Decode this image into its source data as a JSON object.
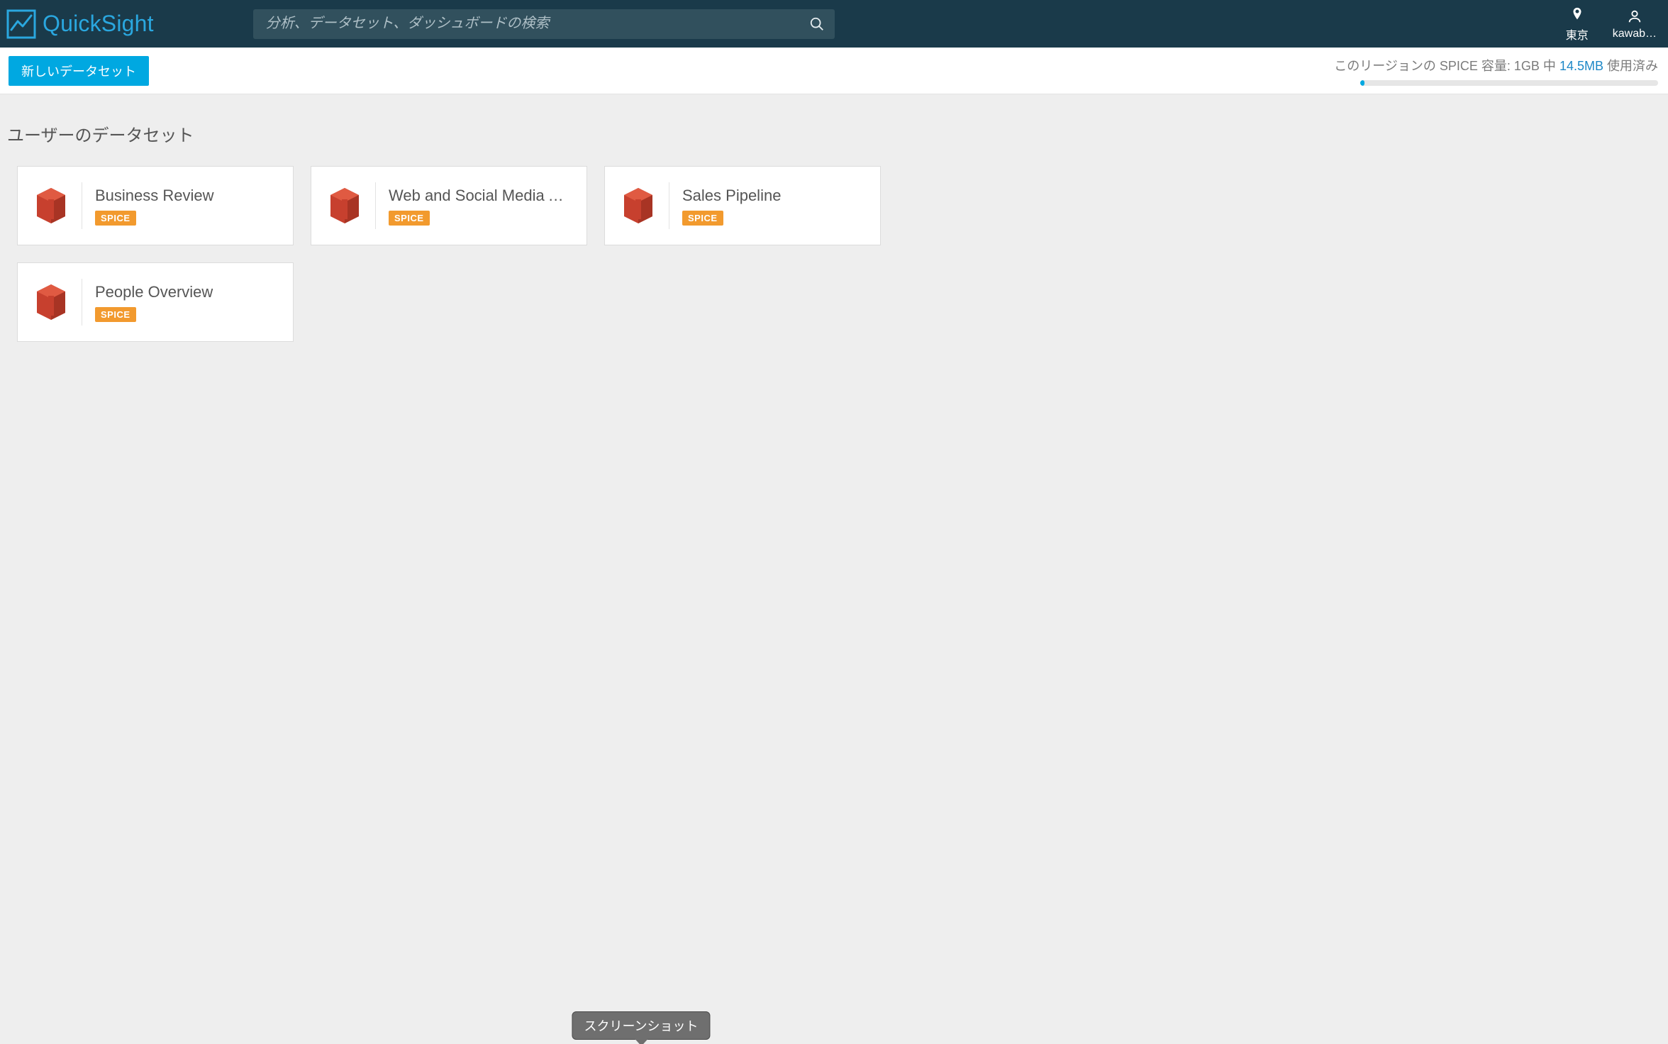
{
  "header": {
    "product_name": "QuickSight",
    "search_placeholder": "分析、データセット、ダッシュボードの検索",
    "region_label": "東京",
    "user_label": "kawab…"
  },
  "subbar": {
    "new_dataset_label": "新しいデータセット",
    "spice_prefix": "このリージョンの SPICE 容量: ",
    "spice_total": "1GB",
    "spice_middle": " 中 ",
    "spice_used": "14.5MB",
    "spice_suffix": " 使用済み",
    "spice_percent": 1.45
  },
  "section": {
    "title": "ユーザーのデータセット"
  },
  "datasets": [
    {
      "title": "Business Review",
      "badge": "SPICE"
    },
    {
      "title": "Web and Social Media A…",
      "badge": "SPICE"
    },
    {
      "title": "Sales Pipeline",
      "badge": "SPICE"
    },
    {
      "title": "People Overview",
      "badge": "SPICE"
    }
  ],
  "tooltip": {
    "label": "スクリーンショット"
  }
}
